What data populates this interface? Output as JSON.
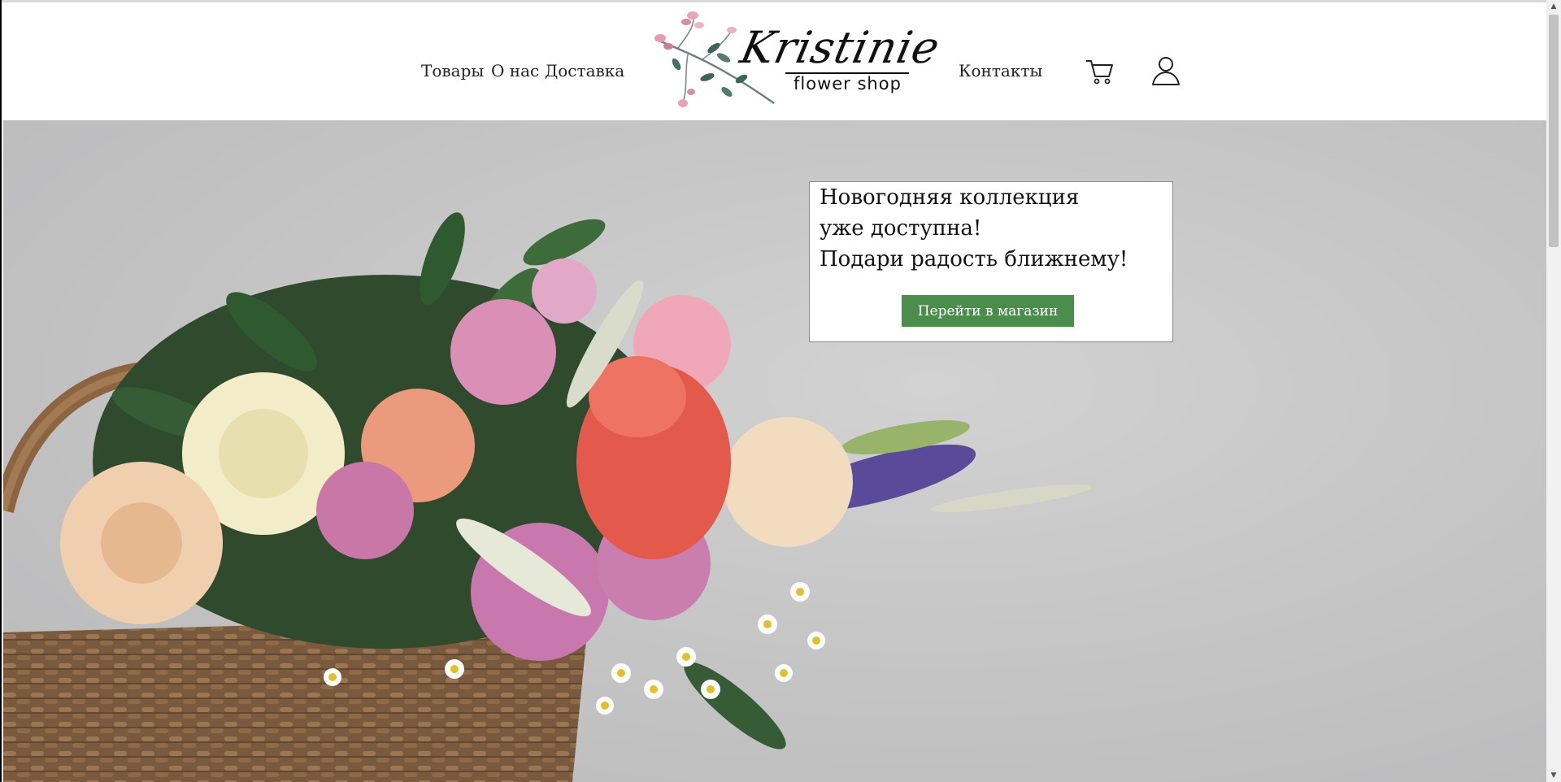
{
  "header": {
    "nav": {
      "products": "Товары",
      "about": "О нас",
      "delivery": "Доставка",
      "contacts": "Контакты"
    },
    "logo": {
      "script_text": "Kristinie",
      "subtitle": "flower shop"
    },
    "icons": {
      "cart": "shopping-cart-icon",
      "user": "user-account-icon"
    }
  },
  "hero": {
    "promo": {
      "line1": "Новогодняя коллекция",
      "line2": "уже доступна!",
      "line3": "Подари радость ближнему!",
      "button_label": "Перейти в магазин"
    },
    "image_subject": "flower-basket-photo"
  },
  "colors": {
    "button_green": "#4b8e4c",
    "hero_background": "#c6c6c6"
  },
  "scrollbar": {
    "up_arrow": "▲",
    "down_arrow": "▼"
  }
}
